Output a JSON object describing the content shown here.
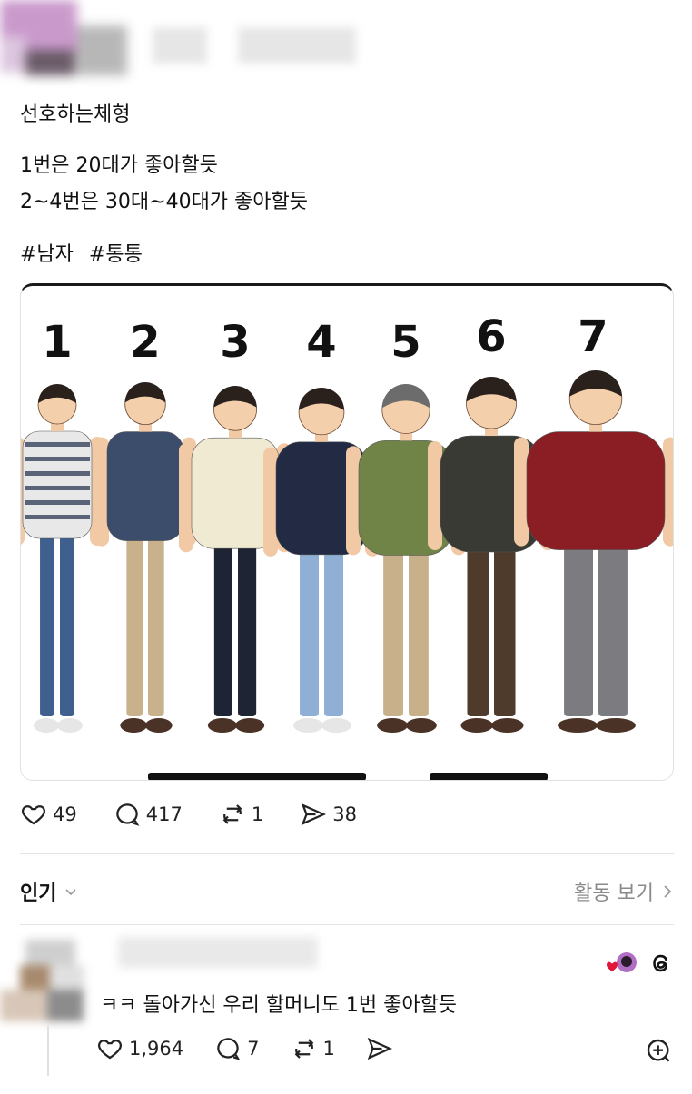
{
  "post": {
    "title": "선호하는체형",
    "line1": "1번은 20대가 좋아할듯",
    "line2": "2~4번은 30대~40대가 좋아할듯",
    "hashtags": [
      "#남자",
      "#통통"
    ]
  },
  "figure": {
    "labels": [
      "1",
      "2",
      "3",
      "4",
      "5",
      "6",
      "7"
    ],
    "shirt_colors": [
      "#e8e8e8",
      "#3c4d6b",
      "#f1ead2",
      "#232a44",
      "#6f8446",
      "#3a3a34",
      "#8b1d24"
    ],
    "pants_colors": [
      "#3f5f8f",
      "#c9b28b",
      "#1f2434",
      "#8fb0d4",
      "#c7b08a",
      "#4e3b2c",
      "#7c7c80"
    ]
  },
  "actions": {
    "likes": "49",
    "comments": "417",
    "reposts": "1",
    "shares": "38"
  },
  "replies_header": {
    "sort": "인기",
    "activity": "활동 보기"
  },
  "reply": {
    "text": "ㅋㅋ 돌아가신 우리 할머니도 1번 좋아할듯",
    "likes": "1,964",
    "comments": "7",
    "reposts": "1"
  },
  "icons": {
    "like": "heart-icon",
    "comment": "comment-bubble-icon",
    "repost": "repost-icon",
    "share": "send-icon",
    "threads": "threads-logo-icon",
    "add": "add-circle-icon"
  }
}
